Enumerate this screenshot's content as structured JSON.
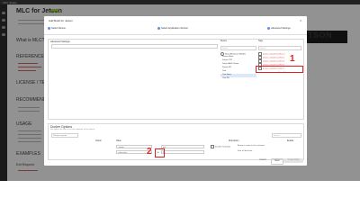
{
  "page": {
    "topbar_title": "CPU Studio",
    "title": "MLC for Jetson",
    "badge": "Docker",
    "sections": [
      "What is MLC?",
      "REFERENCES",
      "LICENSE / TERMS",
      "RECOMMENDED",
      "USAGE",
      "EXAMPLES",
      "Exit Request"
    ],
    "banner_text": "JETSON"
  },
  "dialog": {
    "title": "Add Build for Jetson",
    "close_label": "×",
    "steps": [
      "Select Device",
      "Select Application Version",
      "Advanced Settings"
    ],
    "advanced": {
      "header": "Advanced Settings",
      "description_placeholder": "",
      "device_col": "Device",
      "tags_col": "Tags",
      "device_search": "Search",
      "tags_search": "Search",
      "device_rows": [
        "Show All Jetson Models",
        "Jetson Nano",
        "Jetson TX2",
        "Jetson AGX Xavier",
        "Xavier NX",
        "Orin",
        "Orin Nano",
        "Orin NX"
      ],
      "tag_rows": [
        "jetson-containers-r36.2.0",
        "jetson-containers-r35.4.1",
        "jetson-containers-r36.3.0",
        "jetson-containers-r35.3.1",
        "jetson-containers-r34.1.1"
      ],
      "tags_footer": "Show All"
    },
    "docker": {
      "header": "Docker Options",
      "subtext": "Set options for how to run the container on the device",
      "preset_label": "Choose a preset",
      "search": "Search",
      "col_option": "Option",
      "col_value": "Value",
      "col_description": "Description",
      "col_enable": "Enable",
      "rows": [
        {
          "option": "--name",
          "value": "mlc",
          "description": "Assign a name to the container"
        },
        {
          "option": "--shm-size",
          "value": "8g",
          "description": "Size of /dev/shm"
        }
      ],
      "toggle_label": "Enable Privileged",
      "add_value": "add"
    },
    "buttons": {
      "cancel": "Cancel",
      "back": "Back",
      "submit": "Create Build"
    }
  },
  "annotations": {
    "marker_1": "1",
    "marker_2": "2"
  },
  "colors": {
    "accent": "#5a8dee",
    "annotation_red": "#e02020",
    "badge_green": "#76b900"
  }
}
